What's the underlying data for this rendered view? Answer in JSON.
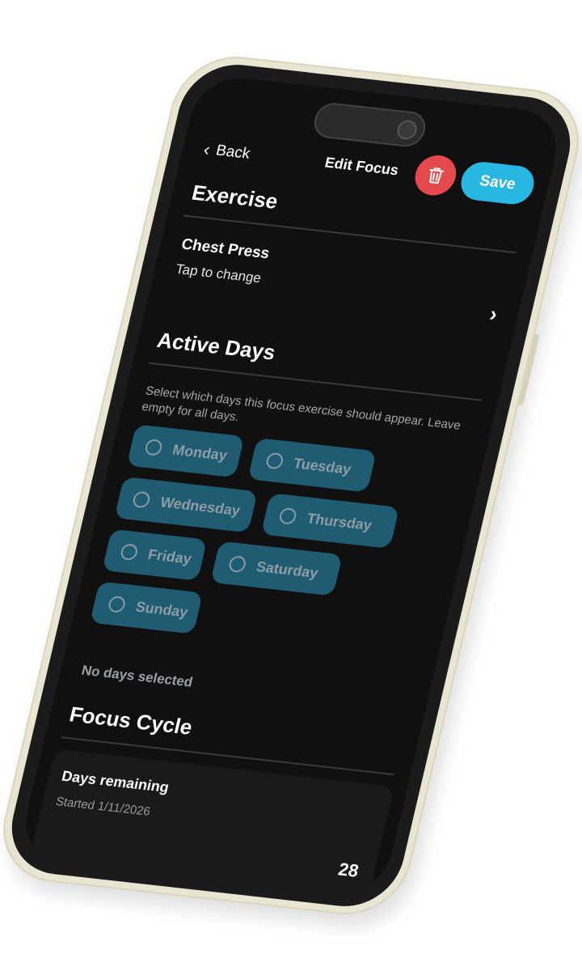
{
  "header": {
    "back_label": "Back",
    "title": "Edit Focus",
    "save_label": "Save",
    "delete_icon": "trash-icon",
    "accent_color": "#28b6e3",
    "danger_color": "#e5484d"
  },
  "exercise": {
    "section_title": "Exercise",
    "name": "Chest Press",
    "hint": "Tap to change"
  },
  "active_days": {
    "section_title": "Active Days",
    "help": "Select which days this focus exercise should appear. Leave empty for all days.",
    "days": [
      {
        "label": "Monday",
        "selected": false
      },
      {
        "label": "Tuesday",
        "selected": false
      },
      {
        "label": "Wednesday",
        "selected": false
      },
      {
        "label": "Thursday",
        "selected": false
      },
      {
        "label": "Friday",
        "selected": false
      },
      {
        "label": "Saturday",
        "selected": false
      },
      {
        "label": "Sunday",
        "selected": false
      }
    ],
    "status": "No days selected"
  },
  "focus_cycle": {
    "section_title": "Focus Cycle",
    "label": "Days remaining",
    "started": "Started 1/11/2026",
    "value": "28"
  }
}
